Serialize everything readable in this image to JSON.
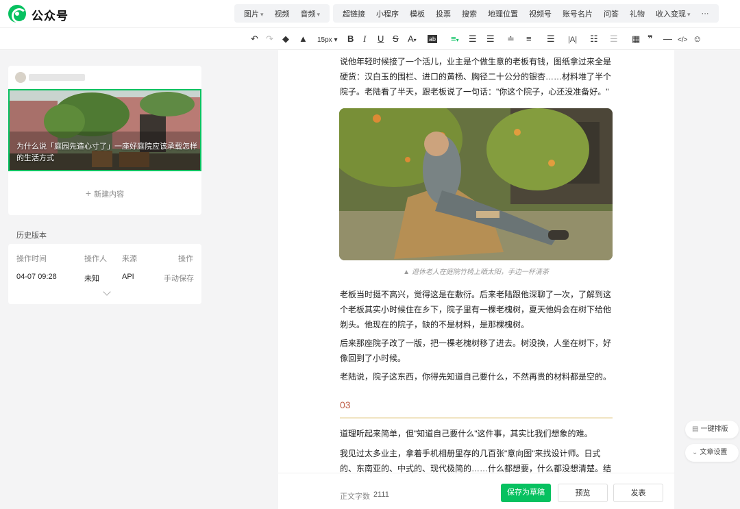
{
  "app": {
    "brand": "公众号"
  },
  "insert_menu": {
    "group1": [
      {
        "label": "图片",
        "dropdown": true
      },
      {
        "label": "视频",
        "dropdown": false
      },
      {
        "label": "音频",
        "dropdown": true
      }
    ],
    "group2": [
      {
        "label": "超链接"
      },
      {
        "label": "小程序"
      },
      {
        "label": "模板"
      },
      {
        "label": "投票"
      },
      {
        "label": "搜索"
      },
      {
        "label": "地理位置"
      },
      {
        "label": "视频号"
      },
      {
        "label": "账号名片"
      },
      {
        "label": "问答"
      },
      {
        "label": "礼物"
      },
      {
        "label": "收入变现",
        "dropdown": true
      },
      {
        "label": "···"
      }
    ]
  },
  "toolbar": {
    "font_size": "15px",
    "icons": [
      "undo-icon",
      "redo-icon",
      "format-painter-icon",
      "clear-format-icon",
      "bold-icon",
      "italic-icon",
      "underline-icon",
      "strikethrough-icon",
      "font-color-icon",
      "background-color-icon",
      "align-icon",
      "indent-icon",
      "outdent-icon",
      "paragraph-spacing-icon",
      "line-height-icon",
      "first-line-indent-icon",
      "letter-spacing-icon",
      "list-icon",
      "two-sides-icon",
      "table-icon",
      "quote-icon",
      "divider-icon",
      "code-icon",
      "emoji-icon"
    ]
  },
  "left_panel": {
    "article_title": "为什么说「庭园先造心寸了」一座好庭院应该承载怎样的生活方式",
    "new_content": "新建内容",
    "history": {
      "title": "历史版本",
      "headers": [
        "操作时间",
        "操作人",
        "来源",
        "操作"
      ],
      "rows": [
        {
          "time": "04-07 09:28",
          "operator": "未知",
          "source": "API",
          "action": "手动保存"
        }
      ]
    }
  },
  "editor": {
    "paragraphs_top": "说他年轻时候接了一个活儿，业主是个做生意的老板有钱，图纸拿过来全是硬货：汉白玉的围栏、进口的黄杨、胸径二十公分的银杏……材料堆了半个院子。老陆看了半天，跟老板说了一句话：\"你这个院子，心还没准备好。\"",
    "image_caption": "▲ 退休老人在庭院竹椅上晒太阳，手边一杯清茶",
    "paragraph_2": "老板当时挺不高兴，觉得这是在敷衍。后来老陆跟他深聊了一次，了解到这个老板其实小时候住在乡下，院子里有一棵老槐树，夏天他妈会在树下给他剃头。他现在的院子，缺的不是材料，是那棵槐树。",
    "paragraph_3": "后来那座院子改了一版，把一棵老槐树移了进去。树没换，人坐在树下，好像回到了小时候。",
    "paragraph_4": "老陆说，院子这东西，你得先知道自己要什么，不然再贵的材料都是空的。",
    "section_number": "03",
    "paragraph_5": "道理听起来简单，但\"知道自己要什么\"这件事，其实比我们想象的难。",
    "paragraph_6": "我见过太多业主，拿着手机相册里存的几百张\"意向图\"来找设计师。日式的、东南亚的、中式的、现代极简的……什么都想要，什么都没想清楚。结果做出"
  },
  "footer": {
    "word_count_label": "正文字数",
    "word_count": "2111",
    "save_label": "保存为草稿",
    "preview_label": "预览",
    "publish_label": "发表"
  },
  "float": {
    "layout_label": "一键排版",
    "settings_label": "文章设置"
  },
  "colors": {
    "accent": "#07c160",
    "section_number": "#c0604a",
    "section_line": "#f0e4c2"
  }
}
